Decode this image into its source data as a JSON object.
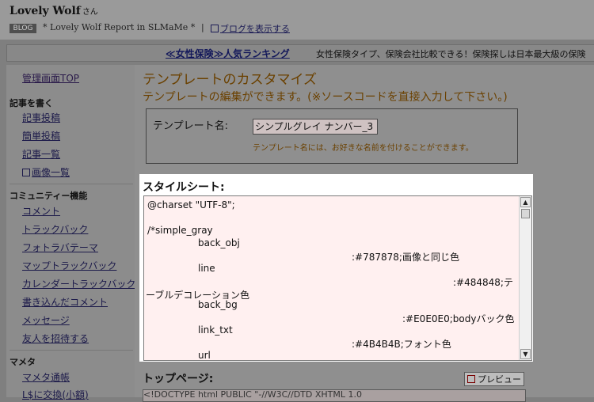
{
  "header": {
    "user_name": "Lovely Wolf",
    "user_suffix": "さん",
    "blog_badge": "BLOG",
    "blog_title": "* Lovely Wolf Report in SLMaMe *",
    "separator": "|",
    "show_blog": "ブログを表示する"
  },
  "ad": {
    "link": "≪女性保険≫人気ランキング",
    "text": "女性保険タイプ、保険会社比較できる！保険探しは日本最大級の保険"
  },
  "sidebar": {
    "top_link": "管理画面TOP",
    "sections": [
      {
        "heading": "記事を書く",
        "items": [
          "記事投稿",
          "簡単投稿",
          "記事一覧",
          "画像一覧"
        ]
      },
      {
        "heading": "コミュニティー機能",
        "items": [
          "コメント",
          "トラックバック",
          "フォトラバテーマ",
          "マップトラックバック",
          "カレンダートラックバック",
          "書き込んだコメント",
          "メッセージ",
          "友人を招待する"
        ]
      },
      {
        "heading": "マメタ",
        "items": [
          "マメタ通帳",
          "L$に交換(小額)"
        ]
      }
    ]
  },
  "main": {
    "title": "テンプレートのカスタマイズ",
    "subtitle": "テンプレートの編集ができます。(※ソースコードを直接入力して下さい。)",
    "template_name_label": "テンプレート名:",
    "template_name_value": "シンプルグレイ ナンバー_3",
    "template_name_hint": "テンプレート名には、お好きな名前を付けることができます。",
    "stylesheet_label": "スタイルシート:",
    "code_lines": [
      "@charset \"UTF-8\";",
      "/*simple_gray",
      "back_obj",
      ":#787878;画像と同じ色",
      "line",
      ":#484848;テ",
      "ーブルデコレーション色",
      "back_bg",
      ":#E0E0E0;bodyバック色",
      "link_txt",
      ":#4B4B4B;フォント色",
      "url"
    ],
    "top_page_label": "トップページ:",
    "preview_label": "プレビュー",
    "bottom_code": "<!DOCTYPE html PUBLIC \"-//W3C//DTD XHTML 1.0"
  }
}
